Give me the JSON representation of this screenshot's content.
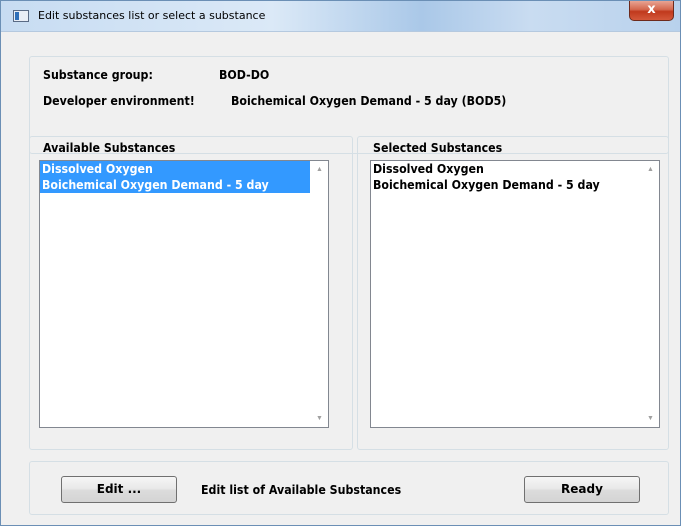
{
  "window": {
    "title": "Edit substances list or select a substance",
    "close_label": "x"
  },
  "group_info": {
    "group_label": "Substance group:",
    "group_value": "BOD-DO",
    "env_label": "Developer environment!",
    "env_value": "Boichemical Oxygen Demand - 5 day (BOD5)"
  },
  "available": {
    "label": "Available Substances",
    "items": [
      {
        "text": "Dissolved Oxygen",
        "selected": true
      },
      {
        "text": "Boichemical Oxygen Demand - 5 day",
        "selected": true
      }
    ]
  },
  "selected_list": {
    "label": "Selected Substances",
    "items": [
      {
        "text": "Dissolved Oxygen"
      },
      {
        "text": "Boichemical Oxygen Demand - 5 day"
      }
    ]
  },
  "bottom": {
    "edit_button": "Edit ...",
    "edit_description": "Edit list of Available Substances",
    "ready_button": "Ready"
  },
  "icons": {
    "scroll_up": "scroll-up-arrow-icon",
    "scroll_down": "scroll-down-arrow-icon",
    "app": "window-app-icon"
  },
  "colors": {
    "selection": "#3399ff",
    "close_button": "#c7462b"
  }
}
